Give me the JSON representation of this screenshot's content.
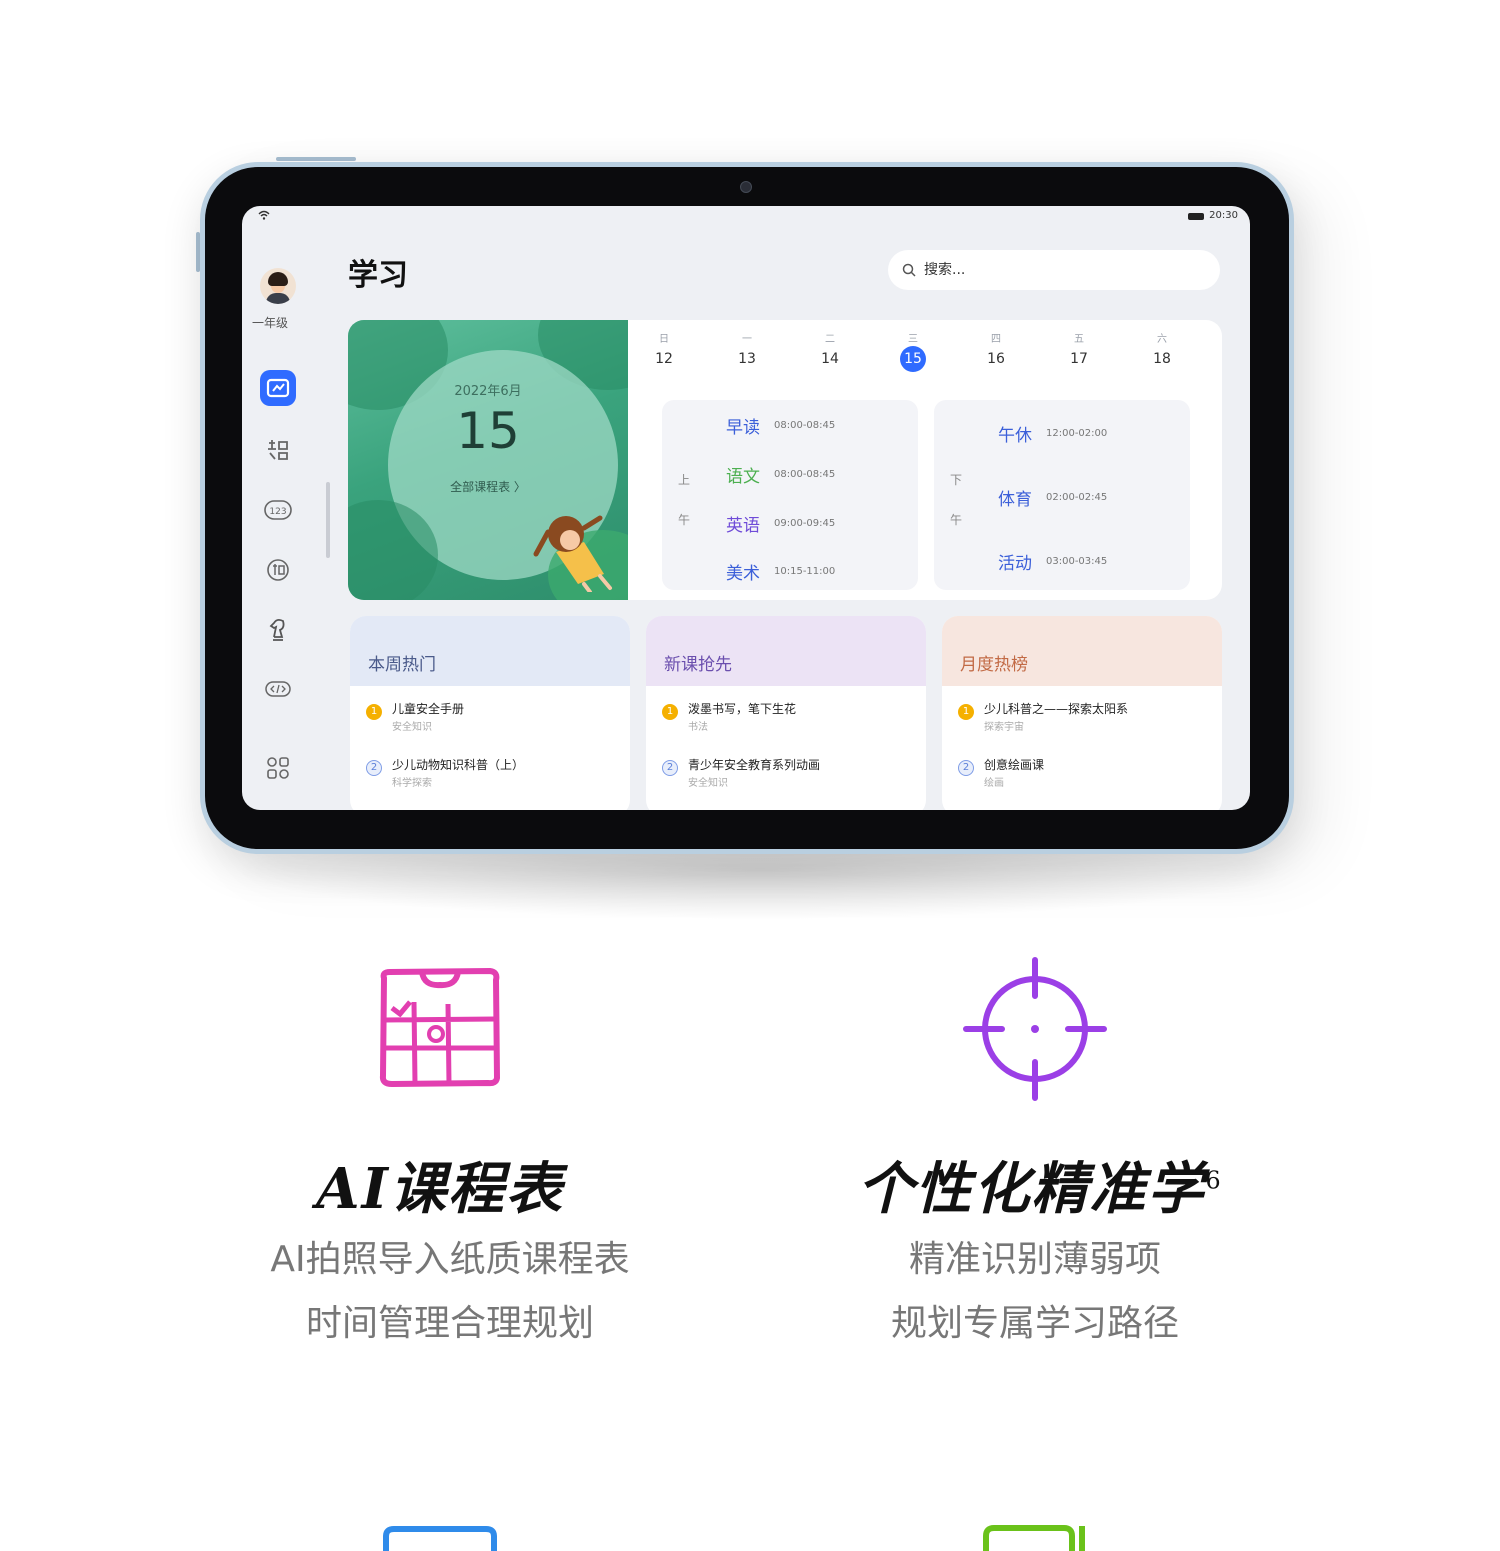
{
  "status_bar": {
    "time": "20:30"
  },
  "sidebar": {
    "grade_label": "一年级",
    "items": [
      {
        "icon": "book-icon",
        "active": true
      },
      {
        "icon": "chinese-character-icon",
        "active": false
      },
      {
        "icon": "math-123-icon",
        "active": false
      },
      {
        "icon": "language-icon",
        "active": false
      },
      {
        "icon": "chess-knight-icon",
        "active": false
      },
      {
        "icon": "code-icon",
        "active": false
      },
      {
        "icon": "apps-grid-icon",
        "active": false
      }
    ]
  },
  "header": {
    "title": "学习",
    "search_placeholder": "搜索..."
  },
  "hero": {
    "date_line": "2022年6月",
    "day": "15",
    "link": "全部课程表 〉"
  },
  "week": [
    {
      "weekday": "日",
      "day": "12",
      "today": false
    },
    {
      "weekday": "一",
      "day": "13",
      "today": false
    },
    {
      "weekday": "二",
      "day": "14",
      "today": false
    },
    {
      "weekday": "三",
      "day": "15",
      "today": true
    },
    {
      "weekday": "四",
      "day": "16",
      "today": false
    },
    {
      "weekday": "五",
      "day": "17",
      "today": false
    },
    {
      "weekday": "六",
      "day": "18",
      "today": false
    }
  ],
  "schedule": {
    "morning": {
      "period": [
        "上",
        "午"
      ],
      "items": [
        {
          "subject": "早读",
          "time": "08:00-08:45",
          "color": "#3b5fd9"
        },
        {
          "subject": "语文",
          "time": "08:00-08:45",
          "color": "#4caf50"
        },
        {
          "subject": "英语",
          "time": "09:00-09:45",
          "color": "#6f4bd8"
        },
        {
          "subject": "美术",
          "time": "10:15-11:00",
          "color": "#3b5fd9"
        }
      ]
    },
    "afternoon": {
      "period": [
        "下",
        "午"
      ],
      "items": [
        {
          "subject": "午休",
          "time": "12:00-02:00",
          "color": "#3b5fd9"
        },
        {
          "subject": "体育",
          "time": "02:00-02:45",
          "color": "#3b5fd9"
        },
        {
          "subject": "活动",
          "time": "03:00-03:45",
          "color": "#3b5fd9"
        }
      ]
    }
  },
  "categories": [
    {
      "title": "本周热门",
      "title_color": "#4a5a8a",
      "head_bg": "#e3e9f6",
      "items": [
        {
          "rank": "1",
          "title": "儿童安全手册",
          "sub": "安全知识"
        },
        {
          "rank": "2",
          "title": "少儿动物知识科普（上）",
          "sub": "科学探索"
        }
      ]
    },
    {
      "title": "新课抢先",
      "title_color": "#6b4fae",
      "head_bg": "#ece3f5",
      "items": [
        {
          "rank": "1",
          "title": "泼墨书写，笔下生花",
          "sub": "书法"
        },
        {
          "rank": "2",
          "title": "青少年安全教育系列动画",
          "sub": "安全知识"
        }
      ]
    },
    {
      "title": "月度热榜",
      "title_color": "#c26a45",
      "head_bg": "#f7e6df",
      "items": [
        {
          "rank": "1",
          "title": "少儿科普之——探索太阳系",
          "sub": "探索宇宙"
        },
        {
          "rank": "2",
          "title": "创意绘画课",
          "sub": "绘画"
        }
      ]
    }
  ],
  "features": [
    {
      "icon": "calendar-icon",
      "icon_color": "#e23fb0",
      "title": "AI课程表",
      "superscript": "",
      "desc": [
        "AI拍照导入纸质课程表",
        "时间管理合理规划"
      ]
    },
    {
      "icon": "crosshair-icon",
      "icon_color": "#9b3fe6",
      "title": "个性化精准学",
      "superscript": "6",
      "desc": [
        "精准识别薄弱项",
        "规划专属学习路径"
      ]
    }
  ],
  "bottom_icons": [
    {
      "icon": "blue-feature-icon",
      "color": "#2f8bea"
    },
    {
      "icon": "green-feature-icon",
      "color": "#6ac21a"
    }
  ]
}
